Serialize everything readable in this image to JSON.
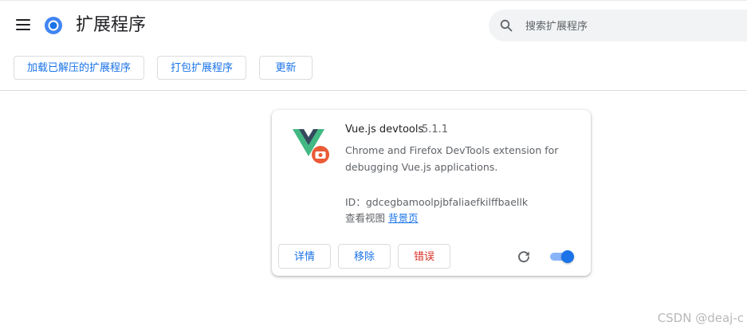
{
  "header": {
    "title": "扩展程序",
    "search_placeholder": "搜索扩展程序"
  },
  "toolbar": {
    "load_unpacked_label": "加载已解压的扩展程序",
    "pack_extension_label": "打包扩展程序",
    "update_label": "更新"
  },
  "extension": {
    "name": "Vue.js devtools",
    "version": "5.1.1",
    "description": "Chrome and Firefox DevTools extension for debugging Vue.js applications.",
    "id_label": "ID：",
    "id_value": "gdcegbamoolpjbfaliaefkilffbaellk",
    "inspect_views_label": "查看视图",
    "background_page_link": "背景页",
    "details_label": "详情",
    "remove_label": "移除",
    "errors_label": "错误",
    "enabled": true
  },
  "colors": {
    "accent": "#1a73e8",
    "error": "#d93025",
    "vue_green": "#42b883",
    "vue_dark": "#35495e"
  },
  "icons": [
    "menu-icon",
    "chrome-logo",
    "search-icon",
    "vue-devtools-logo",
    "reload-icon"
  ],
  "watermark": "CSDN @deaj-c"
}
